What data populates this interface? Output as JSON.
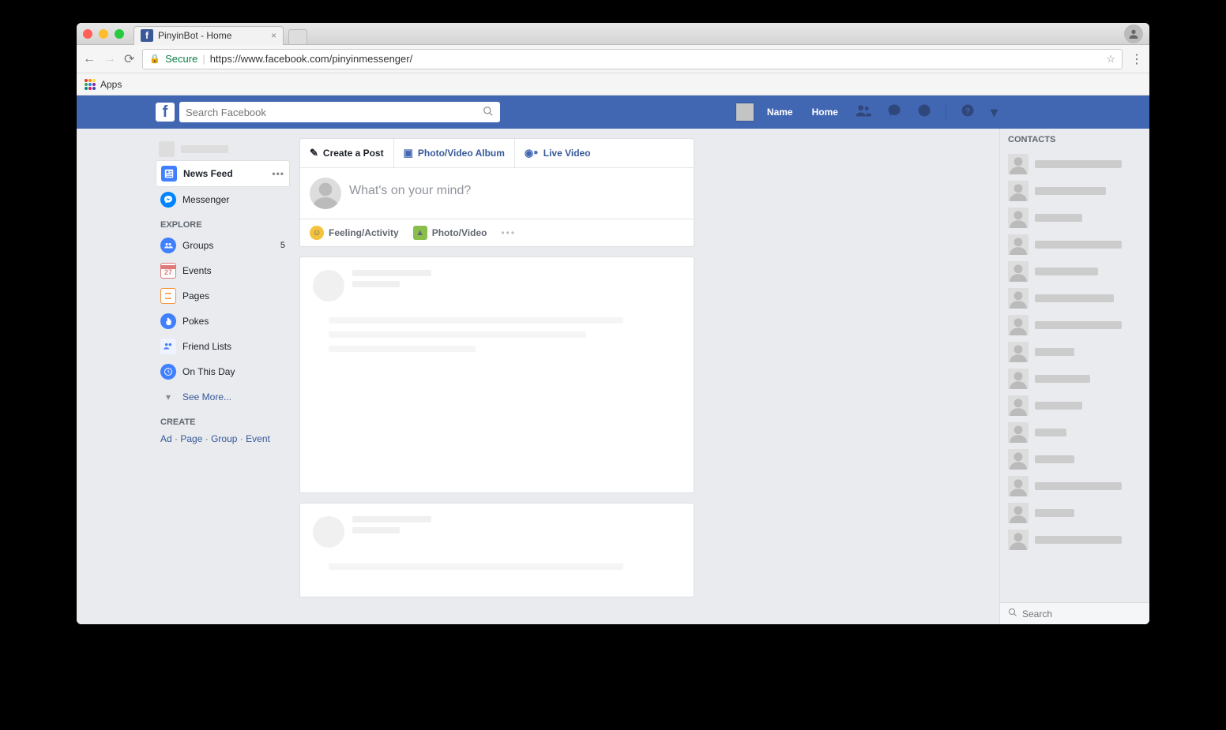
{
  "browser": {
    "tab_title": "PinyinBot - Home",
    "secure_label": "Secure",
    "url_display": "https://www.facebook.com/pinyinmessenger/",
    "apps_label": "Apps"
  },
  "header": {
    "search_placeholder": "Search Facebook",
    "profile_label": "Name",
    "home_label": "Home"
  },
  "leftnav": {
    "news_feed": "News Feed",
    "messenger": "Messenger",
    "explore_label": "EXPLORE",
    "groups": "Groups",
    "groups_badge": "5",
    "events": "Events",
    "events_day": "27",
    "pages": "Pages",
    "pokes": "Pokes",
    "friend_lists": "Friend Lists",
    "on_this_day": "On This Day",
    "see_more": "See More...",
    "create_label": "CREATE",
    "create_ad": "Ad",
    "create_page": "Page",
    "create_group": "Group",
    "create_event": "Event"
  },
  "composer": {
    "create_post": "Create a Post",
    "photo_album": "Photo/Video Album",
    "live_video": "Live Video",
    "placeholder": "What's on your mind?",
    "feeling": "Feeling/Activity",
    "photo_video": "Photo/Video"
  },
  "contacts": {
    "header": "CONTACTS",
    "search_placeholder": "Search",
    "items": [
      110,
      90,
      60,
      110,
      80,
      100,
      110,
      50,
      70,
      60,
      40,
      50,
      110,
      50,
      110
    ]
  }
}
